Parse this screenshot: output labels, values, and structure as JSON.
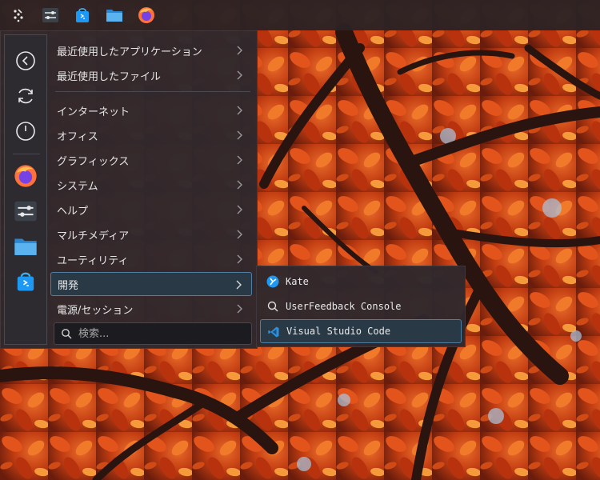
{
  "taskbar": {
    "items": [
      {
        "icon": "application-launcher-icon"
      },
      {
        "icon": "system-settings-icon"
      },
      {
        "icon": "discover-store-icon"
      },
      {
        "icon": "file-manager-icon"
      },
      {
        "icon": "firefox-icon"
      }
    ]
  },
  "launcher": {
    "rail": [
      {
        "icon": "back-icon"
      },
      {
        "icon": "restart-icon"
      },
      {
        "icon": "power-icon"
      },
      {
        "icon": "firefox-icon"
      },
      {
        "icon": "system-settings-icon"
      },
      {
        "icon": "file-manager-icon"
      },
      {
        "icon": "discover-store-icon"
      }
    ],
    "recent": [
      {
        "label": "最近使用したアプリケーション"
      },
      {
        "label": "最近使用したファイル"
      }
    ],
    "categories": [
      {
        "label": "インターネット"
      },
      {
        "label": "オフィス"
      },
      {
        "label": "グラフィックス"
      },
      {
        "label": "システム"
      },
      {
        "label": "ヘルプ"
      },
      {
        "label": "マルチメディア"
      },
      {
        "label": "ユーティリティ"
      },
      {
        "label": "開発",
        "active": true
      },
      {
        "label": "電源/セッション"
      }
    ],
    "search": {
      "placeholder": "検索..."
    }
  },
  "submenu": {
    "items": [
      {
        "label": "Kate",
        "icon": "kate-icon"
      },
      {
        "label": "UserFeedback Console",
        "icon": "search-icon"
      },
      {
        "label": "Visual Studio Code",
        "icon": "vscode-icon",
        "active": true
      }
    ]
  },
  "colors": {
    "panel": "#2c2224",
    "highlight_bg": "#2a3946",
    "highlight_border": "#4e7ea2",
    "accent": "#3daee9"
  }
}
